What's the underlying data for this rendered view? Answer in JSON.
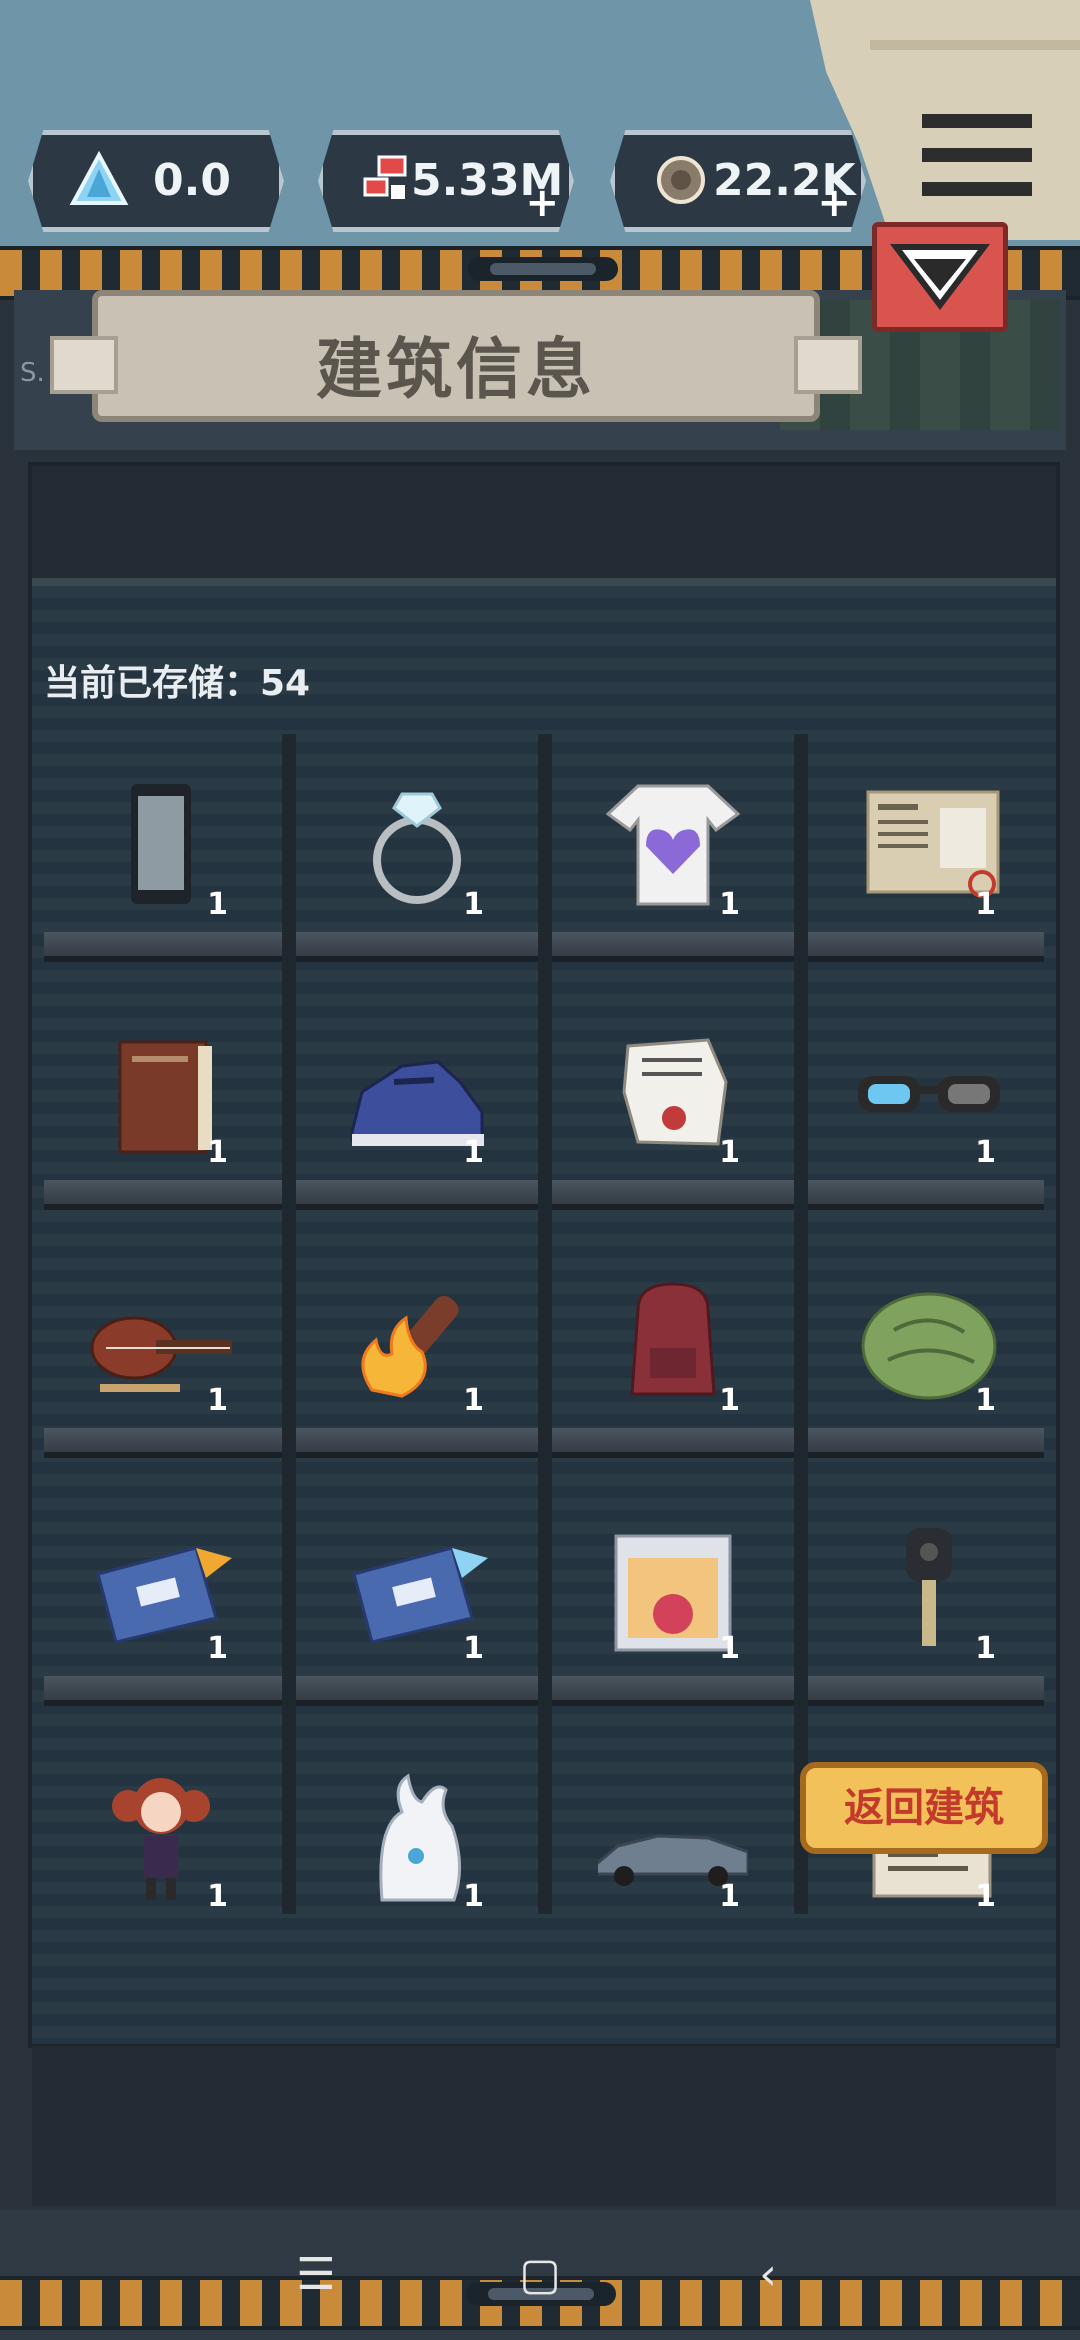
{
  "resources": [
    {
      "name": "crystal",
      "value": "0.0",
      "icon": "crystal-icon",
      "has_plus": false
    },
    {
      "name": "ticket",
      "value": "5.33M",
      "icon": "ticket-icon",
      "has_plus": true
    },
    {
      "name": "coin",
      "value": "22.2K",
      "icon": "coin-icon",
      "has_plus": true
    }
  ],
  "title": "建筑信息",
  "sign_text": "S.",
  "storage_label": "当前已存储：54",
  "return_button": "返回建筑",
  "items": [
    {
      "icon": "phone-icon",
      "count": "1"
    },
    {
      "icon": "diamond-ring-icon",
      "count": "1"
    },
    {
      "icon": "tshirt-icon",
      "count": "1"
    },
    {
      "icon": "newspaper-icon",
      "count": "1"
    },
    {
      "icon": "book-icon",
      "count": "1"
    },
    {
      "icon": "sneaker-icon",
      "count": "1"
    },
    {
      "icon": "letter-icon",
      "count": "1"
    },
    {
      "icon": "glasses-icon",
      "count": "1"
    },
    {
      "icon": "guitar-icon",
      "count": "1"
    },
    {
      "icon": "torch-icon",
      "count": "1"
    },
    {
      "icon": "backpack-icon",
      "count": "1"
    },
    {
      "icon": "cabbage-icon",
      "count": "1"
    },
    {
      "icon": "scroll-icon",
      "count": "1"
    },
    {
      "icon": "scroll-icon",
      "count": "1"
    },
    {
      "icon": "snack-box-icon",
      "count": "1"
    },
    {
      "icon": "key-icon",
      "count": "1"
    },
    {
      "icon": "girl-figure-icon",
      "count": "1"
    },
    {
      "icon": "ghost-pet-icon",
      "count": "1"
    },
    {
      "icon": "car-icon",
      "count": "1"
    },
    {
      "icon": "document-icon",
      "count": "1"
    }
  ],
  "nav": {
    "menu": "☰",
    "home": "▢",
    "back": "‹"
  }
}
